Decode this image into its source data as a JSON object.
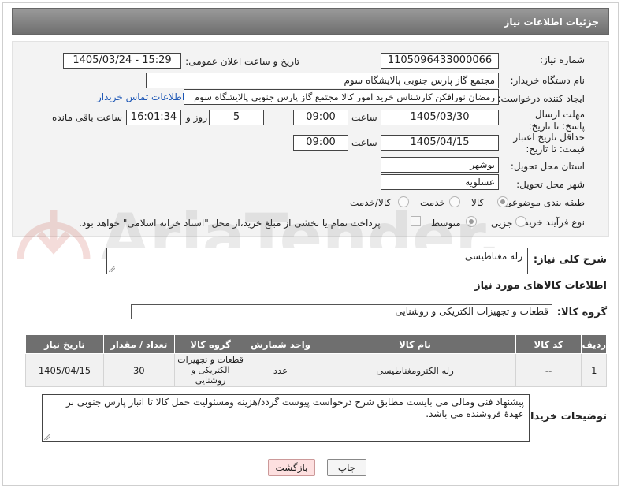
{
  "header": {
    "title": "جزئیات اطلاعات نیاز"
  },
  "form": {
    "need_number_label": "شماره نیاز:",
    "need_number": "1105096433000066",
    "announce_label": "تاریخ و ساعت اعلان عمومی:",
    "announce_value": "1405/03/24 - 15:29",
    "buyer_org_label": "نام دستگاه خریدار:",
    "buyer_org": "مجتمع گاز پارس جنوبی  پالایشگاه سوم",
    "creator_label": "ایجاد کننده درخواست:",
    "creator": "رمضان نورافکن کارشناس خرید امور کالا مجتمع گاز پارس جنوبی  پالایشگاه سوم",
    "contact_link": "اطلاعات تماس خریدار",
    "deadline_label": "مهلت ارسال پاسخ: تا تاریخ:",
    "deadline_date": "1405/03/30",
    "time_label": "ساعت",
    "deadline_time": "09:00",
    "days_count": "5",
    "days_label": "روز و",
    "remaining_time": "16:01:34",
    "remaining_label": "ساعت باقی مانده",
    "validity_label": "حداقل تاریخ اعتبار قیمت: تا تاریخ:",
    "validity_date": "1405/04/15",
    "validity_time": "09:00",
    "province_label": "استان محل تحویل:",
    "province": "بوشهر",
    "city_label": "شهر محل تحویل:",
    "city": "عسلویه",
    "category_label": "طبقه بندی موضوعی:",
    "category_options": [
      "کالا",
      "خدمت",
      "کالا/خدمت"
    ],
    "category_selected": "کالا",
    "process_label": "نوع فرآیند خرید :",
    "process_options": [
      "جزیی",
      "متوسط"
    ],
    "process_selected": "متوسط",
    "payment_note": "پرداخت تمام یا بخشی از مبلغ خرید،از محل \"اسناد خزانه اسلامی\" خواهد بود."
  },
  "description": {
    "label": "شرح کلی نیاز:",
    "value": "رله مغناطیسی"
  },
  "goods_info": {
    "title": "اطلاعات کالاهای مورد نیاز",
    "group_label": "گروه کالا:",
    "group_value": "قطعات و تجهیزات الکتریکی و روشنایی"
  },
  "table": {
    "headers": [
      "ردیف",
      "کد کالا",
      "نام کالا",
      "واحد شمارش",
      "گروه کالا",
      "تعداد / مقدار",
      "تاریخ نیاز"
    ],
    "rows": [
      [
        "1",
        "--",
        "رله الکترومغناطیسی",
        "عدد",
        "قطعات و تجهیزات الکتریکی و روشنایی",
        "30",
        "1405/04/15"
      ]
    ]
  },
  "buyer_notes": {
    "label": "توضیحات خریدار:",
    "value": "پیشنهاد فنی ومالی می بایست مطابق شرح درخواست پیوست گردد/هزینه ومسئولیت حمل کالا تا انبار پارس جنوبی بر عهدهٔ فروشنده می باشد."
  },
  "buttons": {
    "print": "چاپ",
    "back": "بازگشت"
  },
  "watermark": {
    "text": "AriaTender.neT"
  }
}
